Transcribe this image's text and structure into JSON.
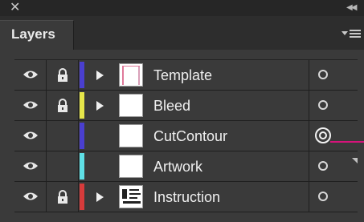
{
  "panel": {
    "tab_label": "Layers"
  },
  "icons": {
    "close": "✕",
    "collapse": "◀◀",
    "panel_menu": "panel-menu-icon"
  },
  "layers": [
    {
      "name": "Template",
      "visible": true,
      "locked": true,
      "color": "#4a3fcf",
      "expandable": true,
      "target_active": false,
      "thumbnail": "template"
    },
    {
      "name": "Bleed",
      "visible": true,
      "locked": true,
      "color": "#e6e64a",
      "expandable": true,
      "target_active": false,
      "thumbnail": "blank"
    },
    {
      "name": "CutContour",
      "visible": true,
      "locked": false,
      "color": "#4a3fcf",
      "expandable": false,
      "target_active": true,
      "thumbnail": "blank"
    },
    {
      "name": "Artwork",
      "visible": true,
      "locked": false,
      "color": "#5fe0e6",
      "expandable": false,
      "target_active": false,
      "thumbnail": "blank"
    },
    {
      "name": "Instruction",
      "visible": true,
      "locked": true,
      "color": "#d63b3b",
      "expandable": true,
      "target_active": false,
      "thumbnail": "instruction"
    }
  ],
  "colors": {
    "selection_indicator": "#d6137a"
  }
}
